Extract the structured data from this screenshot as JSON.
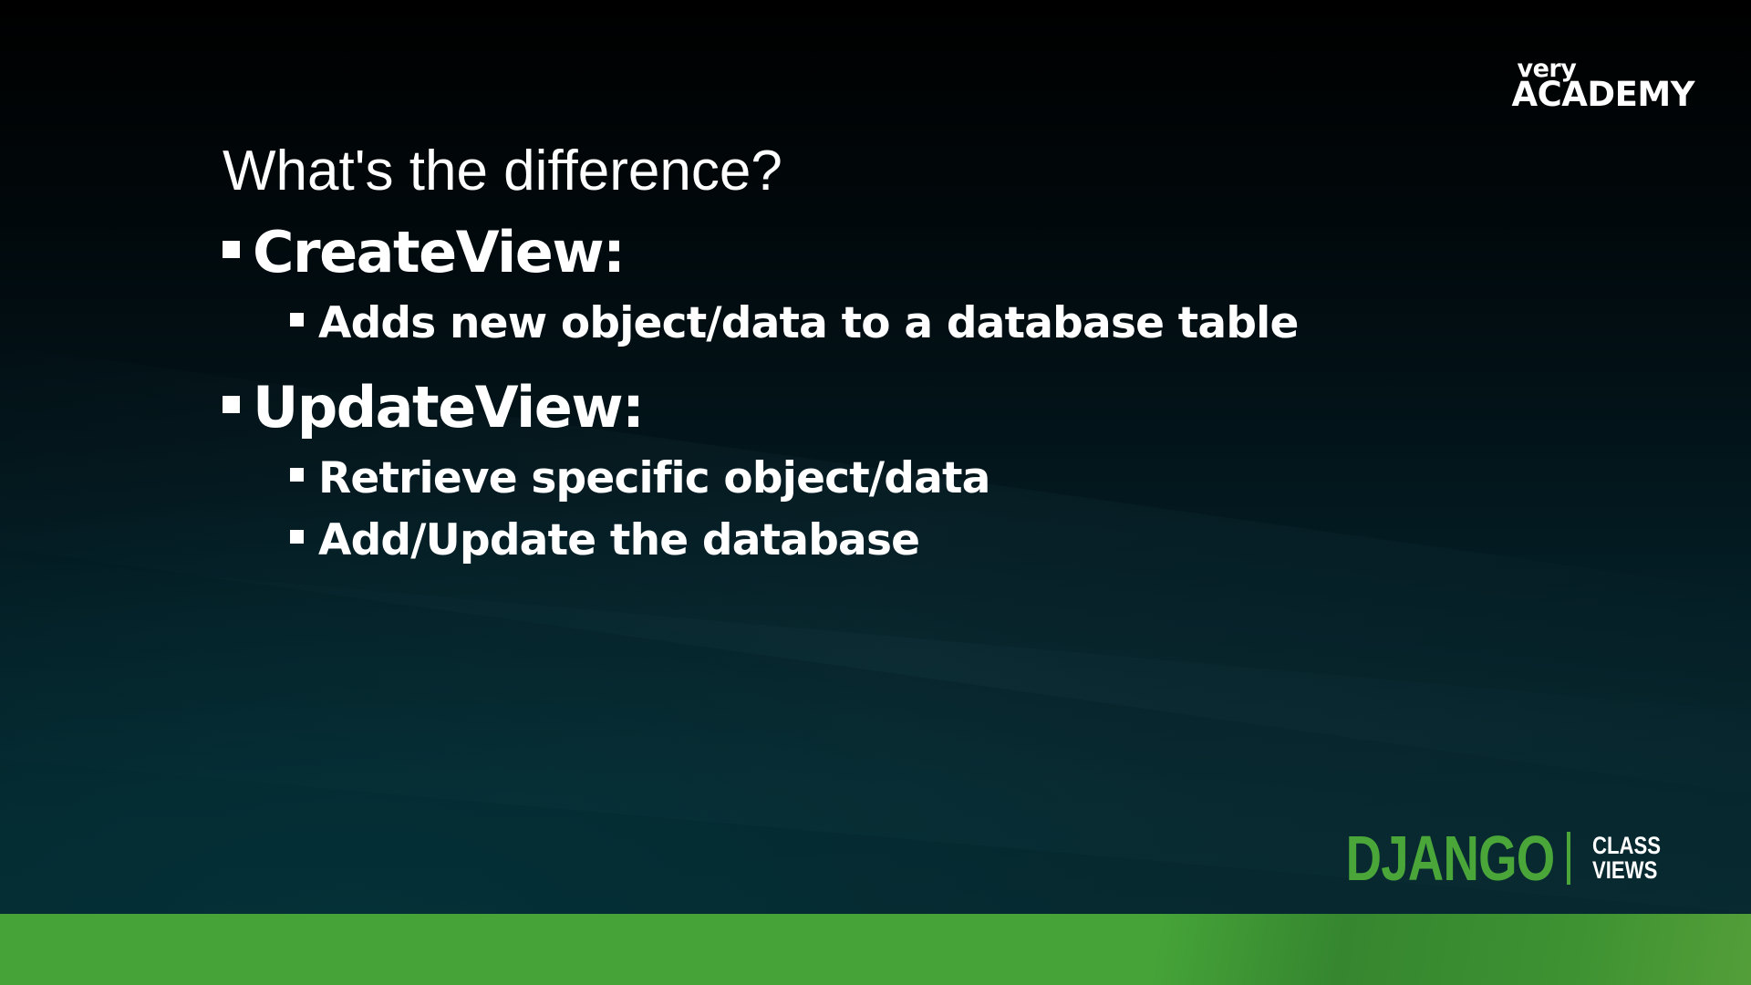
{
  "brand": {
    "small": "very",
    "large": "ACADEMY"
  },
  "slide": {
    "title": "What's the difference?",
    "bullets": [
      {
        "level": 1,
        "text": "CreateView:"
      },
      {
        "level": 2,
        "text": "Adds new object/data to a database table"
      },
      {
        "level": 1,
        "text": "UpdateView:"
      },
      {
        "level": 2,
        "text": "Retrieve specific object/data"
      },
      {
        "level": 2,
        "text": "Add/Update the database"
      }
    ]
  },
  "product": {
    "name": "DJANGO",
    "sub_line1": "CLASS",
    "sub_line2": "VIEWS"
  },
  "colors": {
    "accent_green": "#45a338",
    "logo_green": "#4ba63a",
    "text": "#ffffff",
    "background_dark": "#01080b"
  }
}
